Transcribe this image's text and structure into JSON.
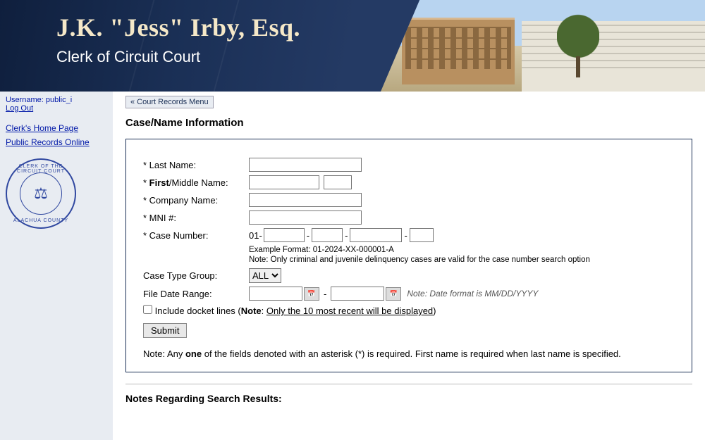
{
  "header": {
    "title": "J.K. \"Jess\" Irby, Esq.",
    "subtitle": "Clerk of Circuit Court"
  },
  "sidebar": {
    "username_label": "Username:",
    "username": "public_i",
    "logout": "Log Out",
    "home_link": "Clerk's Home Page",
    "records_link": "Public Records Online",
    "seal_top": "CLERK OF THE CIRCUIT COURT",
    "seal_bottom": "ALACHUA COUNTY"
  },
  "main": {
    "menu_button": "« Court Records Menu",
    "page_title": "Case/Name Information",
    "labels": {
      "last_name": "Last Name:",
      "first_middle_prefix": "First",
      "first_middle_rest": "/Middle Name:",
      "company": "Company Name:",
      "mni": "MNI #:",
      "case_number": "Case Number:",
      "case_type_group": "Case Type Group:",
      "file_date_range": "File Date Range:"
    },
    "case_prefix": "01-",
    "example_format": "Example Format: 01-2024-XX-000001-A",
    "case_note": "Note: Only criminal and juvenile delinquency cases are valid for the case number search option",
    "case_type_value": "ALL",
    "date_hint": "Note: Date format is MM/DD/YYYY",
    "docket_label_pre": "Include docket lines (",
    "docket_note_word": "Note",
    "docket_label_mid": ": ",
    "docket_underline": "Only the 10 most recent will be displayed",
    "docket_label_post": ")",
    "submit": "Submit",
    "bottom_note_pre": "Note: Any ",
    "bottom_note_bold": "one",
    "bottom_note_post": " of the fields denoted with an asterisk (*) is required. First name is required when last name is specified.",
    "results_heading": "Notes Regarding Search Results:"
  }
}
